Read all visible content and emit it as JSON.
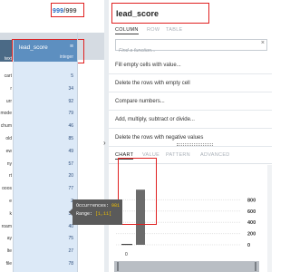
{
  "grid": {
    "count_selected": "999",
    "count_sep": "/",
    "count_total": "999",
    "prev_column_type": "text",
    "column_name": "lead_score",
    "column_menu": "≡",
    "column_type": "integer",
    "rows": [
      {
        "prev": "cart",
        "lead": "5"
      },
      {
        "prev": "r",
        "lead": "34"
      },
      {
        "prev": "urr",
        "lead": "92"
      },
      {
        "prev": "mode",
        "lead": "79"
      },
      {
        "prev": "chum",
        "lead": "46"
      },
      {
        "prev": "old",
        "lead": "85"
      },
      {
        "prev": "ew",
        "lead": "49"
      },
      {
        "prev": "ny",
        "lead": "57"
      },
      {
        "prev": "rt",
        "lead": "20"
      },
      {
        "prev": "ooos",
        "lead": "77"
      },
      {
        "prev": "e",
        "lead": "2"
      },
      {
        "prev": "k",
        "lead": "35"
      },
      {
        "prev": "roam",
        "lead": "40"
      },
      {
        "prev": "ay",
        "lead": "75"
      },
      {
        "prev": "lte",
        "lead": "27"
      },
      {
        "prev": "file",
        "lead": "78"
      }
    ]
  },
  "tooltip": {
    "occ_label": "Occurrences:",
    "occ_value": "981",
    "range_label": "Range:",
    "range_value": "[1,11["
  },
  "panel": {
    "collapse_icon": "›",
    "title": "lead_score",
    "tabs_top": [
      "COLUMN",
      "ROW",
      "TABLE"
    ],
    "search_placeholder": "Find a function...",
    "search_clear": "×",
    "suggestions": [
      "Fill empty cells with value...",
      "Delete the rows with empty cell",
      "Compare numbers...",
      "Add, multiply, subtract or divide...",
      "Delete the rows with negative values"
    ],
    "tabs_bottom": [
      "CHART",
      "VALUE",
      "PATTERN",
      "ADVANCED"
    ]
  },
  "chart_data": {
    "type": "bar",
    "categories": [
      "[1,11["
    ],
    "values": [
      981
    ],
    "yticks": [
      "800",
      "600",
      "400",
      "200",
      "0"
    ],
    "ylim": [
      0,
      1000
    ],
    "xtick": "0"
  },
  "colors": {
    "header_blue": "#5d8fc0",
    "column_bg": "#dce9f7",
    "highlight_red": "#e02020",
    "bar_color": "#6b6b6b"
  }
}
